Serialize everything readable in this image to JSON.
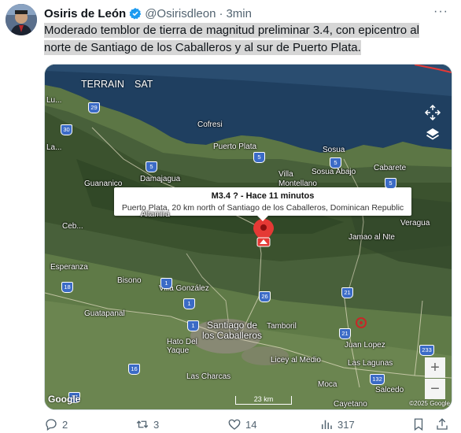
{
  "tweet": {
    "author_name": "Osiris de León",
    "handle": "@Osirisdleon",
    "separator": "·",
    "time": "3min",
    "more": "···",
    "text": "Moderado temblor de tierra de magnitud preliminar 3.4, con epicentro al norte de Santiago de los Caballeros y al sur de Puerto Plata."
  },
  "map": {
    "tabs": [
      "TERRAIN",
      "SAT"
    ],
    "callout_title": "M3.4 ?  -  Hace 11 minutos",
    "callout_subtitle": "Puerto Plata, 20 km north of Santiago de los Caballeros, Dominican Republic",
    "places": {
      "cofresi": "Cofresi",
      "puerto_plata": "Puerto Plata",
      "sosua": "Sosua",
      "sosua_abajo": "Sosua Abajo",
      "cabarete": "Cabarete",
      "villa_montellano": "Villa\nMontellano",
      "guananico": "Guananico",
      "damajagua": "Damajagua",
      "altamira": "Altamira",
      "jamao": "Jamao al Nte",
      "veragua": "Veragua",
      "esperanza": "Esperanza",
      "bisono": "Bisono",
      "villa_gonzalez": "Villa González",
      "guatapanal": "Guatapanal",
      "santiago": "Santiago de\nlos Caballeros",
      "tamboril": "Tamboril",
      "hato_del_yaque": "Hato Del\nYaque",
      "licey": "Licey al Medio",
      "juan_lopez": "Juan Lopez",
      "las_lagunas": "Las Lagunas",
      "las_charcas": "Las Charcas",
      "moca": "Moca",
      "salcedo": "Salcedo",
      "cayetano": "Cayetano",
      "luperon": "Lu...",
      "la_isabela": "La...",
      "ceb": "Ceb..."
    },
    "shields": [
      "29",
      "30",
      "5",
      "5",
      "5",
      "5",
      "18",
      "1",
      "1",
      "26",
      "21",
      "21",
      "1",
      "132",
      "16",
      "17",
      "233"
    ],
    "zoom_in": "+",
    "zoom_out": "−",
    "attribution": "Google",
    "scale": "23 km",
    "copyright": "©2025 Google"
  },
  "actions": {
    "replies": "2",
    "retweets": "3",
    "likes": "14",
    "views": "317"
  },
  "colors": {
    "verified": "#1d9bf0",
    "pin": "#e53935",
    "epicenter_ring": "#c62828",
    "text_highlight": "#d6d6d6"
  }
}
